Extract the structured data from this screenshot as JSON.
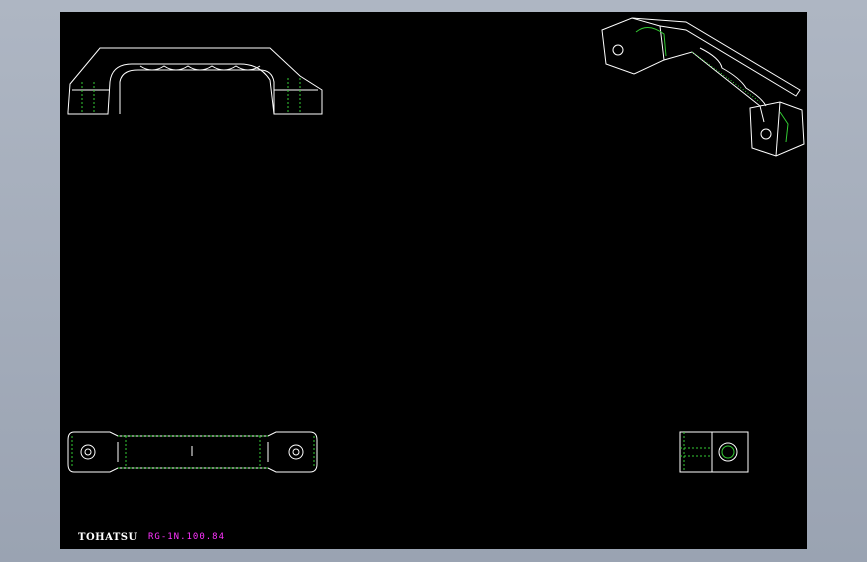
{
  "colors": {
    "background": "#a6aebb",
    "viewport": "#000000",
    "outline": "#ffffff",
    "hidden_line": "#33cc33",
    "drawing_code": "#ff33ff"
  },
  "title_block": {
    "brand": "TOHATSU",
    "drawing_number": "RG-1N.100.84"
  }
}
